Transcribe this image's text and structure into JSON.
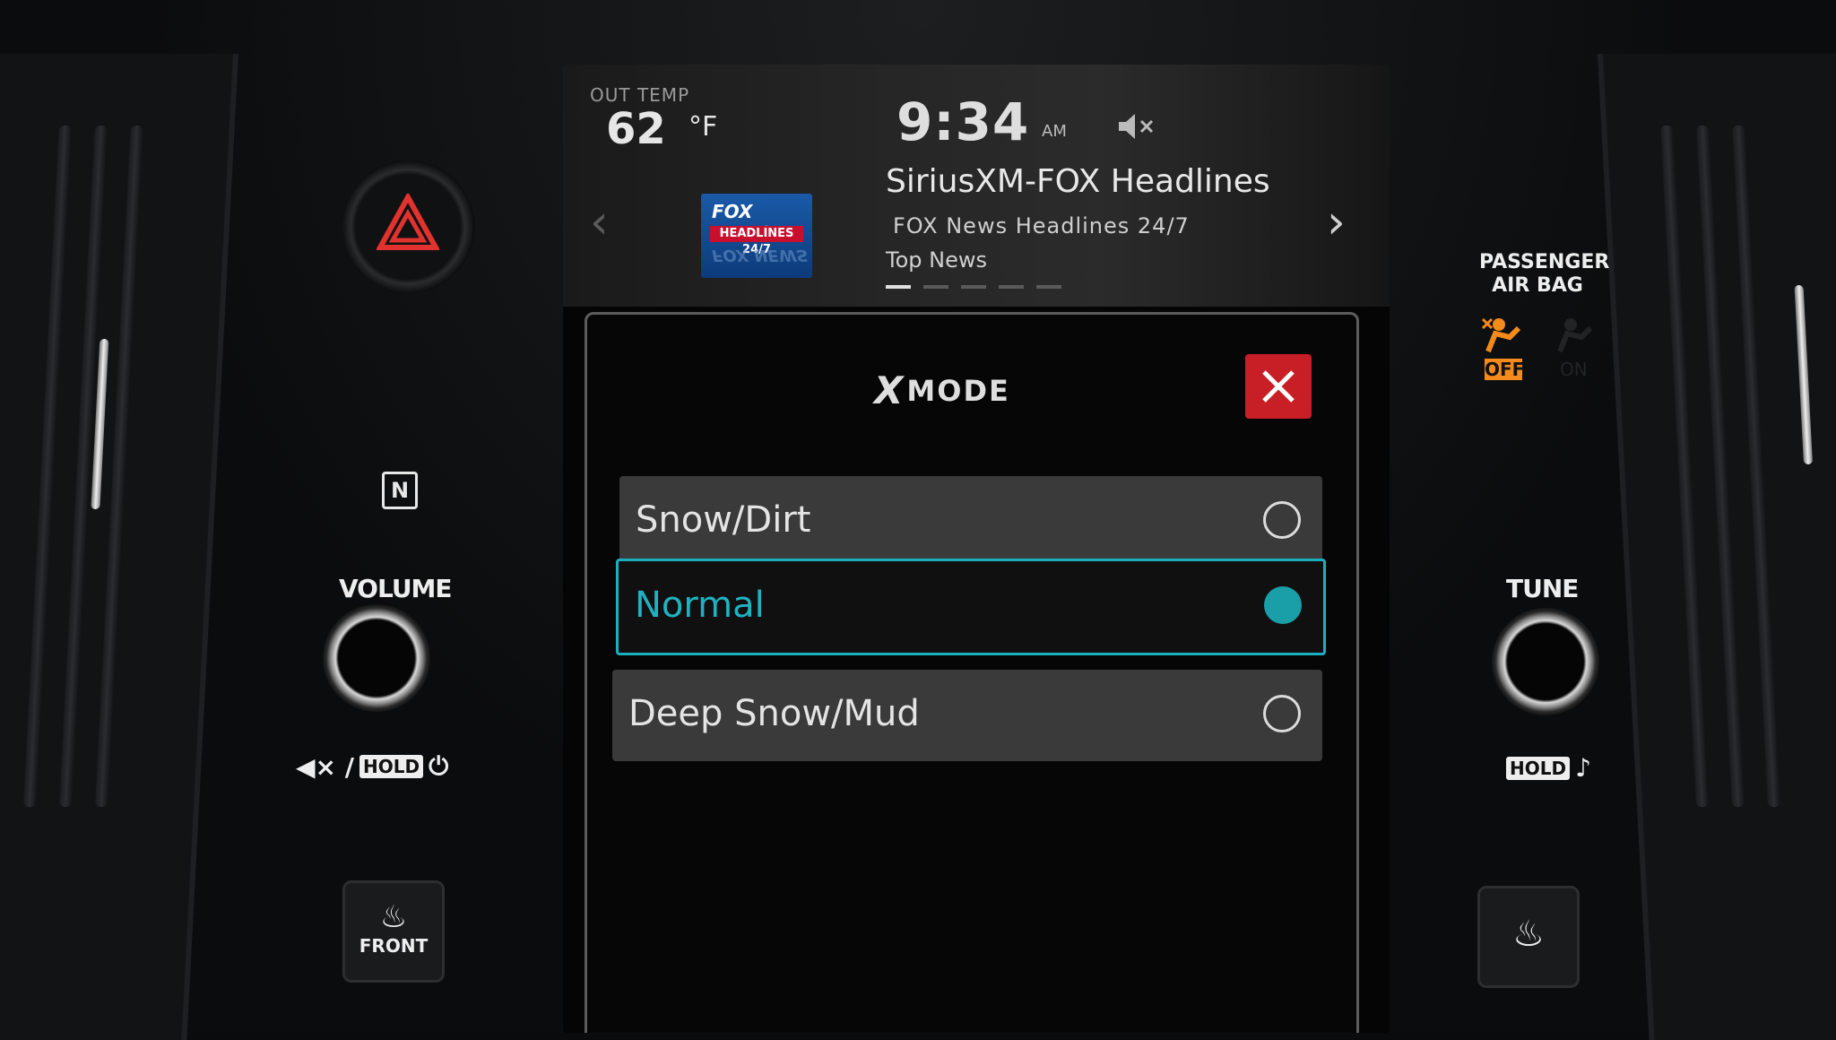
{
  "screen": {
    "out_temp_label": "OUT TEMP",
    "out_temp_value": "62",
    "out_temp_unit": "°F",
    "clock": "9:34",
    "ampm": "AM",
    "mute_icon": "speaker-muted-icon"
  },
  "now_playing": {
    "logo_line1": "FOX NEWS",
    "logo_line2": "HEADLINES 24/7",
    "channel_name": "SiriusXM-FOX Headlines",
    "channel_desc": "FOX News Headlines 24/7",
    "category": "Top News",
    "page_count": 5,
    "active_page": 1
  },
  "xmode_dialog": {
    "logo_text": "X",
    "title": "MODE",
    "options": [
      {
        "label": "Snow/Dirt",
        "selected": false
      },
      {
        "label": "Normal",
        "selected": true
      },
      {
        "label": "Deep Snow/Mud",
        "selected": false
      }
    ],
    "accent_color": "#1ab0bf",
    "close_color": "#c81e26"
  },
  "console": {
    "volume_label": "VOLUME",
    "volume_hold_text": "HOLD",
    "volume_mute_text": "◀× /",
    "tune_label": "TUNE",
    "tune_hold_text": "HOLD",
    "front_defrost_label": "FRONT",
    "airbag_line1": "PASSENGER",
    "airbag_line2": "AIR BAG",
    "airbag_off_text": "OFF",
    "airbag_on_text": "ON",
    "nfc_text": "N"
  }
}
